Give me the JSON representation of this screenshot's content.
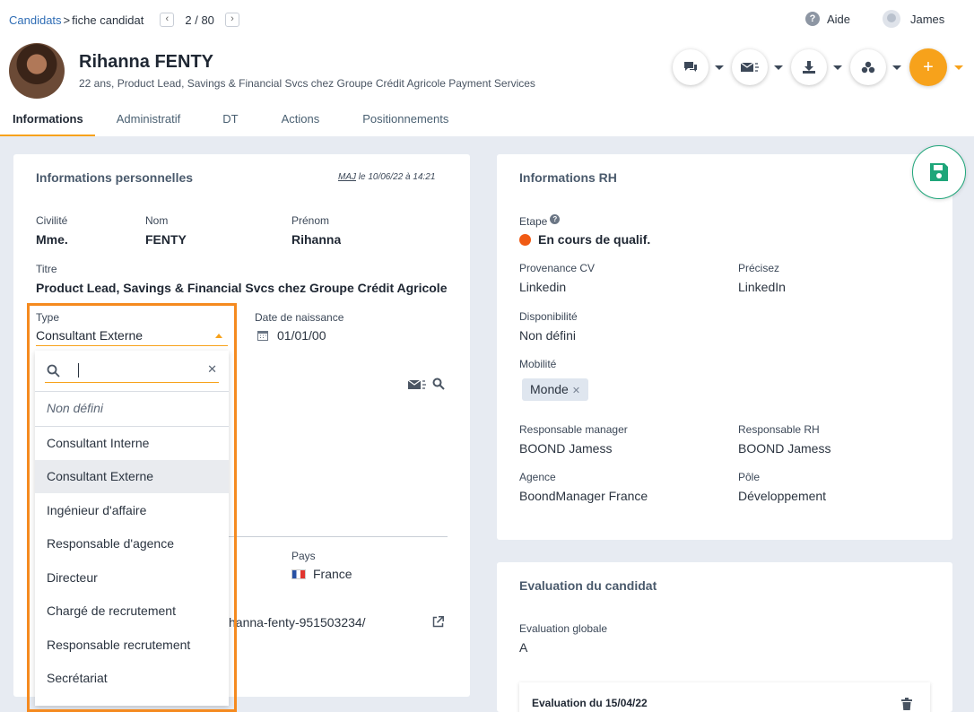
{
  "breadcrumb": {
    "root": "Candidats",
    "separator": ">",
    "current": "fiche candidat"
  },
  "pager": {
    "prev": "‹",
    "text": "2 / 80",
    "next": "›"
  },
  "help": {
    "icon": "?",
    "label": "Aide"
  },
  "user": {
    "name": "James"
  },
  "candidate": {
    "name": "Rihanna FENTY",
    "subtitle": "22 ans, Product Lead, Savings & Financial Svcs chez Groupe Crédit Agricole Payment Services"
  },
  "action_buttons": [
    {
      "icon": "chat-icon",
      "glyph": "💬"
    },
    {
      "icon": "mail-icon",
      "glyph": "✉"
    },
    {
      "icon": "download-icon",
      "glyph": "⤓"
    },
    {
      "icon": "share-icon",
      "glyph": "⚙"
    },
    {
      "icon": "plus-icon",
      "glyph": "+"
    }
  ],
  "tabs": [
    {
      "label": "Informations",
      "active": true
    },
    {
      "label": "Administratif"
    },
    {
      "label": "DT"
    },
    {
      "label": "Actions"
    },
    {
      "label": "Positionnements"
    }
  ],
  "perso": {
    "title": "Informations personnelles",
    "maj_prefix": "MAJ",
    "maj_suffix": " le 10/06/22 à 14:21",
    "civilite_label": "Civilité",
    "civilite": "Mme.",
    "nom_label": "Nom",
    "nom": "FENTY",
    "prenom_label": "Prénom",
    "prenom": "Rihanna",
    "titre_label": "Titre",
    "titre": "Product Lead, Savings & Financial Svcs chez Groupe Crédit Agricole Payments",
    "type_label": "Type",
    "type_value": "Consultant Externe",
    "dob_label": "Date de naissance",
    "dob": "01/01/00",
    "pays_label": "Pays",
    "pays": "France",
    "linkedin_partial": "hanna-fenty-951503234/"
  },
  "dropdown": {
    "search_value": "",
    "options": [
      {
        "label": "Non défini",
        "style": "none"
      },
      {
        "label": "Consultant Interne"
      },
      {
        "label": "Consultant Externe",
        "selected": true
      },
      {
        "label": "Ingénieur d'affaire"
      },
      {
        "label": "Responsable d'agence"
      },
      {
        "label": "Directeur"
      },
      {
        "label": "Chargé de recrutement"
      },
      {
        "label": "Responsable recrutement"
      },
      {
        "label": "Secrétariat"
      }
    ]
  },
  "rh": {
    "title": "Informations RH",
    "etape_label": "Etape",
    "etape": "En cours de qualif.",
    "etape_color": "#f05a14",
    "provenance_label": "Provenance CV",
    "provenance": "Linkedin",
    "precisez_label": "Précisez",
    "precisez": "LinkedIn",
    "dispo_label": "Disponibilité",
    "dispo": "Non défini",
    "mobilite_label": "Mobilité",
    "mobilite_tag": "Monde",
    "resp_manager_label": "Responsable manager",
    "resp_manager": "BOOND Jamess",
    "resp_rh_label": "Responsable RH",
    "resp_rh": "BOOND Jamess",
    "agence_label": "Agence",
    "agence": "BoondManager France",
    "pole_label": "Pôle",
    "pole": "Développement"
  },
  "evaluation": {
    "title": "Evaluation du candidat",
    "globale_label": "Evaluation globale",
    "globale": "A",
    "entry_title": "Evaluation du 15/04/22"
  },
  "colors": {
    "accent": "#f7a21b",
    "highlight": "#f58a1f",
    "save": "#1fa67a",
    "link": "#2f6db5"
  }
}
